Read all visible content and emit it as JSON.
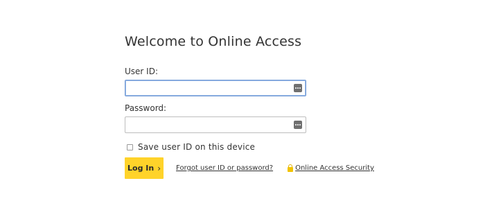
{
  "login": {
    "title": "Welcome to Online Access",
    "user_id_label": "User ID:",
    "user_id_value": "",
    "password_label": "Password:",
    "password_value": "",
    "remember_label": "Save user ID on this device",
    "remember_checked": false,
    "login_button_label": "Log In",
    "forgot_link": "Forgot user ID or password?",
    "security_link": "Online Access Security"
  },
  "colors": {
    "login_button": "#ffd32a",
    "lock_icon": "#f2c300",
    "focused_border": "#6f98d6"
  }
}
